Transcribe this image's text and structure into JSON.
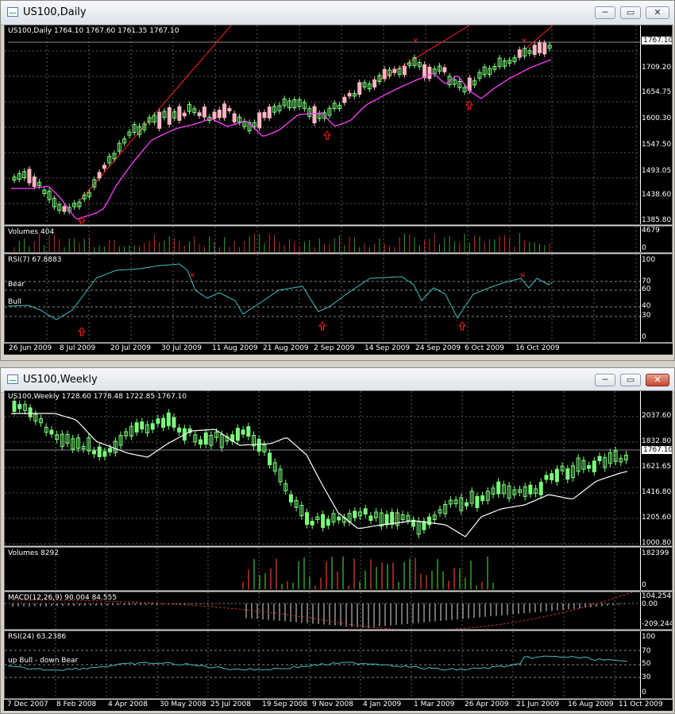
{
  "daily_window": {
    "title": "US100,Daily",
    "buttons": {
      "minimize": "─",
      "restore": "▭",
      "close": "✕"
    },
    "price_label": "US100,Daily  1764.10 1767.60 1761.35 1767.10",
    "price_axis": [
      "1767.10",
      "1709.20",
      "1654.75",
      "1600.30",
      "1547.50",
      "1493.05",
      "1438.60",
      "1385.80"
    ],
    "current_price": "1767.10",
    "volumes_label": "Volumes 404",
    "volumes_axis": [
      "4679",
      "0"
    ],
    "rsi_label": "RSI(7) 67.8883",
    "rsi_axis": [
      "100",
      "70",
      "60",
      "40",
      "30",
      "0"
    ],
    "rsi_level_labels": {
      "bear": "Bear",
      "bull": "Bull"
    },
    "dates": [
      "26 Jun 2009",
      "8 Jul 2009",
      "20 Jul 2009",
      "30 Jul 2009",
      "11 Aug 2009",
      "21 Aug 2009",
      "2 Sep 2009",
      "14 Sep 2009",
      "24 Sep 2009",
      "6 Oct 2009",
      "16 Oct 2009"
    ]
  },
  "weekly_window": {
    "title": "US100,Weekly",
    "buttons": {
      "minimize": "─",
      "restore": "▭",
      "close": "✕"
    },
    "price_label": "US100,Weekly  1728.60 1778.48 1722.85 1767.10",
    "price_axis": [
      "2037.60",
      "1832.80",
      "1621.65",
      "1416.80",
      "1205.60",
      "1000.80"
    ],
    "current_price": "1767.10",
    "volumes_label": "Volumes 8292",
    "volumes_axis": [
      "182399",
      "0"
    ],
    "macd_label": "MACD(12,26,9) 90.004 84.555",
    "macd_axis": [
      "104.254",
      "0.00",
      "-209.244"
    ],
    "rsi_label": "RSI(24) 63.2386",
    "rsi_axis": [
      "100",
      "70",
      "50",
      "30",
      "0"
    ],
    "rsi_level_label": "up Bull - down Bear",
    "dates": [
      "7 Dec 2007",
      "8 Feb 2008",
      "4 Apr 2008",
      "30 May 2008",
      "25 Jul 2008",
      "19 Sep 2008",
      "9 Nov 2008",
      "4 Jan 2009",
      "1 Mar 2009",
      "26 Apr 2009",
      "21 Jun 2009",
      "16 Aug 2009",
      "11 Oct 2009"
    ]
  },
  "colors": {
    "bull_candle": "#7cfc7c",
    "bear_candle": "#ffb6c1",
    "ma_daily": "#ff40ff",
    "ma_weekly": "#ffffff",
    "rsi_line": "#40c0c0",
    "trendline": "#ff2020",
    "grid": "#5a5a5a",
    "arrow": "#ff2020"
  }
}
